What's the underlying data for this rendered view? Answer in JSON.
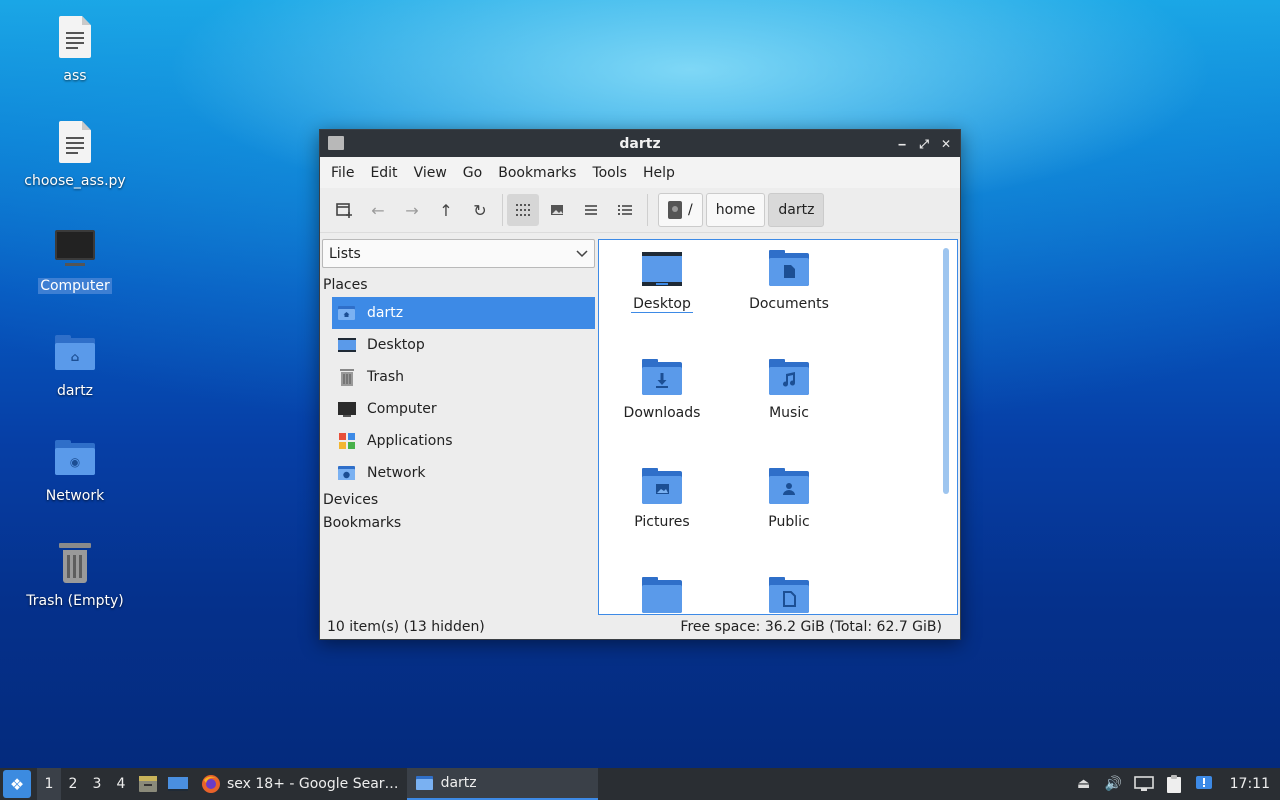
{
  "desktop": {
    "icons": [
      {
        "label": "ass",
        "icon": "text-file-icon"
      },
      {
        "label": "choose_ass.py",
        "icon": "text-file-icon"
      },
      {
        "label": "Computer",
        "icon": "computer-icon"
      },
      {
        "label": "dartz",
        "icon": "home-folder-icon"
      },
      {
        "label": "Network",
        "icon": "network-folder-icon"
      },
      {
        "label": "Trash (Empty)",
        "icon": "trash-icon"
      }
    ]
  },
  "window": {
    "title": "dartz",
    "menu": [
      "File",
      "Edit",
      "View",
      "Go",
      "Bookmarks",
      "Tools",
      "Help"
    ],
    "breadcrumbs": [
      "/",
      "home",
      "dartz"
    ],
    "side_mode": "Lists",
    "sections": {
      "places": "Places",
      "devices": "Devices",
      "bookmarks": "Bookmarks"
    },
    "places": [
      {
        "label": "dartz",
        "icon": "home-folder-icon"
      },
      {
        "label": "Desktop",
        "icon": "desktop-icon"
      },
      {
        "label": "Trash",
        "icon": "trash-icon"
      },
      {
        "label": "Computer",
        "icon": "computer-icon"
      },
      {
        "label": "Applications",
        "icon": "applications-icon"
      },
      {
        "label": "Network",
        "icon": "network-icon"
      }
    ],
    "files": [
      {
        "label": "Desktop",
        "icon": "desktop-folder-icon"
      },
      {
        "label": "Documents",
        "icon": "documents-folder-icon"
      },
      {
        "label": "Downloads",
        "icon": "downloads-folder-icon"
      },
      {
        "label": "Music",
        "icon": "music-folder-icon"
      },
      {
        "label": "Pictures",
        "icon": "pictures-folder-icon"
      },
      {
        "label": "Public",
        "icon": "public-folder-icon"
      },
      {
        "label": "",
        "icon": "folder-icon"
      },
      {
        "label": "",
        "icon": "templates-folder-icon"
      }
    ],
    "status": {
      "items": "10 item(s) (13 hidden)",
      "free_space": "Free space: 36.2 GiB (Total: 62.7 GiB)"
    }
  },
  "taskbar": {
    "workspaces": [
      "1",
      "2",
      "3",
      "4"
    ],
    "tasks": [
      {
        "label": "sex 18+ - Google Sear…",
        "icon": "firefox-icon"
      },
      {
        "label": "dartz",
        "icon": "folder-icon"
      }
    ],
    "clock": "17:11"
  },
  "colors": {
    "accent": "#3d8ae6",
    "titlebar": "#2f343a",
    "folder": "#5a9aea",
    "taskbar": "#2a2e33"
  }
}
